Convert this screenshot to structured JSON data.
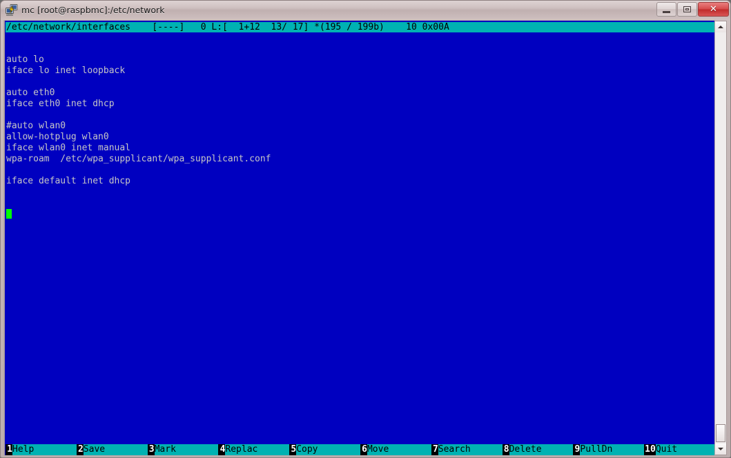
{
  "window": {
    "title": "mc [root@raspbmc]:/etc/network",
    "icon": "putty-terminal-icon",
    "controls": {
      "minimize_label": "–",
      "maximize_label": "□",
      "close_label": "✕"
    }
  },
  "colors": {
    "terminal_background": "#0000C0",
    "header_background": "#00B2B2",
    "text_foreground": "#C6C6C6",
    "cursor": "#00FF00",
    "fnkey_number_background": "#000000",
    "fnkey_number_foreground": "#FFFFFF",
    "frame": "#C3B5B5"
  },
  "editor": {
    "status_line": "/etc/network/interfaces    [----]   0 L:[  1+12  13/ 17] *(195 / 199b)    10 0x00A",
    "filename": "/etc/network/interfaces",
    "modified_flag": "[----]",
    "column_indicator": "0",
    "line_indicator": "L:[  1+12  13/ 17]",
    "byte_indicator": "*(195 / 199b)",
    "char_code_decimal": "10",
    "char_code_hex": "0x00A",
    "total_lines": 17,
    "current_line": 13,
    "cursor_row": 13,
    "cursor_col": 1,
    "lines": [
      "auto lo",
      "iface lo inet loopback",
      "",
      "auto eth0",
      "iface eth0 inet dhcp",
      "",
      "#auto wlan0",
      "allow-hotplug wlan0",
      "iface wlan0 inet manual",
      "wpa-roam  /etc/wpa_supplicant/wpa_supplicant.conf",
      "",
      "iface default inet dhcp"
    ]
  },
  "function_keys": [
    {
      "num": "1",
      "label": "Help"
    },
    {
      "num": "2",
      "label": "Save"
    },
    {
      "num": "3",
      "label": "Mark"
    },
    {
      "num": "4",
      "label": "Replac"
    },
    {
      "num": "5",
      "label": "Copy"
    },
    {
      "num": "6",
      "label": "Move"
    },
    {
      "num": "7",
      "label": "Search"
    },
    {
      "num": "8",
      "label": "Delete"
    },
    {
      "num": "9",
      "label": "PullDn"
    },
    {
      "num": "10",
      "label": "Quit"
    }
  ],
  "scrollbar": {
    "up_arrow": "scroll-up-arrow",
    "down_arrow": "scroll-down-arrow",
    "thumb_position": "bottom"
  }
}
